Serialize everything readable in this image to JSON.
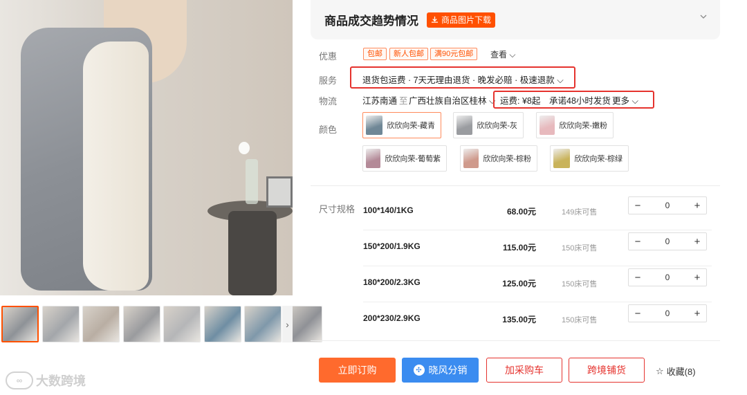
{
  "trend": {
    "title": "商品成交趋势情况",
    "download_label": "商品图片下载",
    "download_icon": "download-icon",
    "chevron_icon": "chevron-down-icon"
  },
  "labels": {
    "discount": "优惠",
    "service": "服务",
    "logistics": "物流",
    "color": "颜色",
    "size": "尺寸规格"
  },
  "coupons": [
    "包邮",
    "新人包邮",
    "满90元包邮"
  ],
  "see_more": "查看",
  "service_text": "退货包运费 · 7天无理由退货 · 晚发必赔 · 极速退款",
  "logistics": {
    "from": "江苏南通",
    "to_word": "至",
    "to": "广西壮族自治区桂林",
    "fee": "运费: ¥8起",
    "promise": "承诺48小时发货",
    "more": "更多"
  },
  "colors": [
    {
      "name": "欣欣向荣-藏青",
      "swatch": "#6f8796",
      "selected": true
    },
    {
      "name": "欣欣向荣-灰",
      "swatch": "#9a9ca0",
      "selected": false
    },
    {
      "name": "欣欣向荣-嫩粉",
      "swatch": "#e7b9bd",
      "selected": false
    },
    {
      "name": "欣欣向荣-葡萄紫",
      "swatch": "#b48a98",
      "selected": false
    },
    {
      "name": "欣欣向荣-棕粉",
      "swatch": "#cf9a8c",
      "selected": false
    },
    {
      "name": "欣欣向荣-棕绿",
      "swatch": "#c9b35a",
      "selected": false
    }
  ],
  "skus": [
    {
      "name": "100*140/1KG",
      "price": "68.00元",
      "stock": "149床可售",
      "qty": "0"
    },
    {
      "name": "150*200/1.9KG",
      "price": "115.00元",
      "stock": "150床可售",
      "qty": "0"
    },
    {
      "name": "180*200/2.3KG",
      "price": "125.00元",
      "stock": "150床可售",
      "qty": "0"
    },
    {
      "name": "200*230/2.9KG",
      "price": "135.00元",
      "stock": "150床可售",
      "qty": "0"
    }
  ],
  "stepper": {
    "minus": "−",
    "plus": "+"
  },
  "actions": {
    "buy": "立即订购",
    "fenxiao": "晓风分销",
    "cart": "加采购车",
    "distribute": "跨境铺货",
    "favorite": "收藏(8)"
  },
  "thumb_colors": [
    "#8e9297",
    "#a3a6aa",
    "#b9aea3",
    "#9a9b9e",
    "#b5b6b8",
    "#6f8ea3",
    "#7f98aa",
    "#8f9196"
  ],
  "watermark": {
    "logo": "∞",
    "text": "大数跨境"
  }
}
